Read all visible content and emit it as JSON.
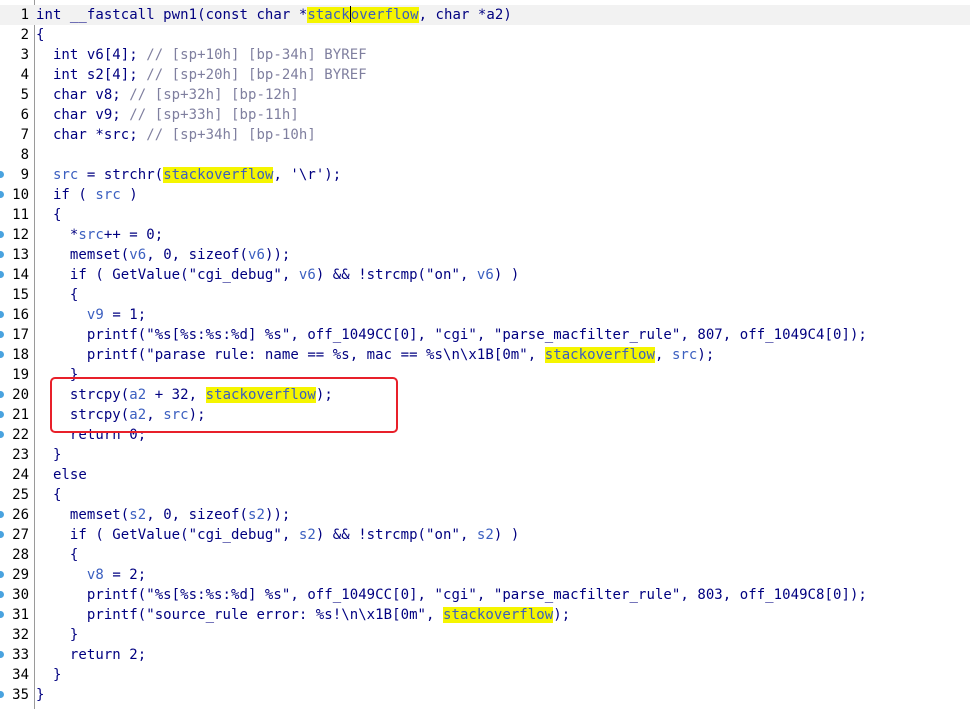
{
  "editor": {
    "current_line": 1,
    "highlight_word": "stackoverflow",
    "colors": {
      "text": "#000080",
      "variable": "#3b5fc0",
      "comment": "#7f7f9f",
      "highlight": "#f5f500",
      "annotation_box": "#e8202a",
      "breakpoint_dot": "#4aa3df"
    },
    "annotation": "red-box-around-lines-20-21",
    "lines": [
      {
        "num": "1",
        "dot": false,
        "tokens": [
          {
            "t": "int __fastcall pwn1(const char *",
            "k": "n"
          },
          {
            "t": "stack",
            "k": "hl"
          },
          {
            "t": "",
            "k": "caret"
          },
          {
            "t": "overflow",
            "k": "hl"
          },
          {
            "t": ", char *a2)",
            "k": "n"
          }
        ]
      },
      {
        "num": "2",
        "dot": false,
        "tokens": [
          {
            "t": "{",
            "k": "n"
          }
        ]
      },
      {
        "num": "3",
        "dot": false,
        "tokens": [
          {
            "t": "  int v6[4]; ",
            "k": "n"
          },
          {
            "t": "// [sp+10h] [bp-34h] BYREF",
            "k": "c"
          }
        ]
      },
      {
        "num": "4",
        "dot": false,
        "tokens": [
          {
            "t": "  int s2[4]; ",
            "k": "n"
          },
          {
            "t": "// [sp+20h] [bp-24h] BYREF",
            "k": "c"
          }
        ]
      },
      {
        "num": "5",
        "dot": false,
        "tokens": [
          {
            "t": "  char v8; ",
            "k": "n"
          },
          {
            "t": "// [sp+32h] [bp-12h]",
            "k": "c"
          }
        ]
      },
      {
        "num": "6",
        "dot": false,
        "tokens": [
          {
            "t": "  char v9; ",
            "k": "n"
          },
          {
            "t": "// [sp+33h] [bp-11h]",
            "k": "c"
          }
        ]
      },
      {
        "num": "7",
        "dot": false,
        "tokens": [
          {
            "t": "  char *src; ",
            "k": "n"
          },
          {
            "t": "// [sp+34h] [bp-10h]",
            "k": "c"
          }
        ]
      },
      {
        "num": "8",
        "dot": false,
        "tokens": [
          {
            "t": "",
            "k": "n"
          }
        ]
      },
      {
        "num": "9",
        "dot": true,
        "tokens": [
          {
            "t": "  ",
            "k": "n"
          },
          {
            "t": "src",
            "k": "v"
          },
          {
            "t": " = strchr(",
            "k": "n"
          },
          {
            "t": "stackoverflow",
            "k": "hl"
          },
          {
            "t": ", '\\r');",
            "k": "n"
          }
        ]
      },
      {
        "num": "10",
        "dot": true,
        "tokens": [
          {
            "t": "  if ( ",
            "k": "n"
          },
          {
            "t": "src",
            "k": "v"
          },
          {
            "t": " )",
            "k": "n"
          }
        ]
      },
      {
        "num": "11",
        "dot": false,
        "tokens": [
          {
            "t": "  {",
            "k": "n"
          }
        ]
      },
      {
        "num": "12",
        "dot": true,
        "tokens": [
          {
            "t": "    *",
            "k": "n"
          },
          {
            "t": "src",
            "k": "v"
          },
          {
            "t": "++ = 0;",
            "k": "n"
          }
        ]
      },
      {
        "num": "13",
        "dot": true,
        "tokens": [
          {
            "t": "    memset(",
            "k": "n"
          },
          {
            "t": "v6",
            "k": "v"
          },
          {
            "t": ", 0, sizeof(",
            "k": "n"
          },
          {
            "t": "v6",
            "k": "v"
          },
          {
            "t": "));",
            "k": "n"
          }
        ]
      },
      {
        "num": "14",
        "dot": true,
        "tokens": [
          {
            "t": "    if ( GetValue(\"cgi_debug\", ",
            "k": "n"
          },
          {
            "t": "v6",
            "k": "v"
          },
          {
            "t": ") && !strcmp(\"on\", ",
            "k": "n"
          },
          {
            "t": "v6",
            "k": "v"
          },
          {
            "t": ") )",
            "k": "n"
          }
        ]
      },
      {
        "num": "15",
        "dot": false,
        "tokens": [
          {
            "t": "    {",
            "k": "n"
          }
        ]
      },
      {
        "num": "16",
        "dot": true,
        "tokens": [
          {
            "t": "      ",
            "k": "n"
          },
          {
            "t": "v9",
            "k": "v"
          },
          {
            "t": " = 1;",
            "k": "n"
          }
        ]
      },
      {
        "num": "17",
        "dot": true,
        "tokens": [
          {
            "t": "      printf(\"%s[%s:%s:%d] %s\", off_1049CC[0], \"cgi\", \"parse_macfilter_rule\", 807, off_1049C4[0]);",
            "k": "n"
          }
        ]
      },
      {
        "num": "18",
        "dot": true,
        "tokens": [
          {
            "t": "      printf(\"parase rule: name == %s, mac == %s\\n\\x1B[0m\", ",
            "k": "n"
          },
          {
            "t": "stackoverflow",
            "k": "hl"
          },
          {
            "t": ", ",
            "k": "n"
          },
          {
            "t": "src",
            "k": "v"
          },
          {
            "t": ");",
            "k": "n"
          }
        ]
      },
      {
        "num": "19",
        "dot": false,
        "tokens": [
          {
            "t": "    }",
            "k": "n"
          }
        ]
      },
      {
        "num": "20",
        "dot": true,
        "tokens": [
          {
            "t": "    strcpy(",
            "k": "n"
          },
          {
            "t": "a2",
            "k": "v"
          },
          {
            "t": " + 32, ",
            "k": "n"
          },
          {
            "t": "stackoverflow",
            "k": "hl"
          },
          {
            "t": ");",
            "k": "n"
          }
        ]
      },
      {
        "num": "21",
        "dot": true,
        "tokens": [
          {
            "t": "    strcpy(",
            "k": "n"
          },
          {
            "t": "a2",
            "k": "v"
          },
          {
            "t": ", ",
            "k": "n"
          },
          {
            "t": "src",
            "k": "v"
          },
          {
            "t": ");",
            "k": "n"
          }
        ]
      },
      {
        "num": "22",
        "dot": true,
        "tokens": [
          {
            "t": "    return 0;",
            "k": "n"
          }
        ]
      },
      {
        "num": "23",
        "dot": false,
        "tokens": [
          {
            "t": "  }",
            "k": "n"
          }
        ]
      },
      {
        "num": "24",
        "dot": false,
        "tokens": [
          {
            "t": "  else",
            "k": "n"
          }
        ]
      },
      {
        "num": "25",
        "dot": false,
        "tokens": [
          {
            "t": "  {",
            "k": "n"
          }
        ]
      },
      {
        "num": "26",
        "dot": true,
        "tokens": [
          {
            "t": "    memset(",
            "k": "n"
          },
          {
            "t": "s2",
            "k": "v"
          },
          {
            "t": ", 0, sizeof(",
            "k": "n"
          },
          {
            "t": "s2",
            "k": "v"
          },
          {
            "t": "));",
            "k": "n"
          }
        ]
      },
      {
        "num": "27",
        "dot": true,
        "tokens": [
          {
            "t": "    if ( GetValue(\"cgi_debug\", ",
            "k": "n"
          },
          {
            "t": "s2",
            "k": "v"
          },
          {
            "t": ") && !strcmp(\"on\", ",
            "k": "n"
          },
          {
            "t": "s2",
            "k": "v"
          },
          {
            "t": ") )",
            "k": "n"
          }
        ]
      },
      {
        "num": "28",
        "dot": false,
        "tokens": [
          {
            "t": "    {",
            "k": "n"
          }
        ]
      },
      {
        "num": "29",
        "dot": true,
        "tokens": [
          {
            "t": "      ",
            "k": "n"
          },
          {
            "t": "v8",
            "k": "v"
          },
          {
            "t": " = 2;",
            "k": "n"
          }
        ]
      },
      {
        "num": "30",
        "dot": true,
        "tokens": [
          {
            "t": "      printf(\"%s[%s:%s:%d] %s\", off_1049CC[0], \"cgi\", \"parse_macfilter_rule\", 803, off_1049C8[0]);",
            "k": "n"
          }
        ]
      },
      {
        "num": "31",
        "dot": true,
        "tokens": [
          {
            "t": "      printf(\"source_rule error: %s!\\n\\x1B[0m\", ",
            "k": "n"
          },
          {
            "t": "stackoverflow",
            "k": "hl"
          },
          {
            "t": ");",
            "k": "n"
          }
        ]
      },
      {
        "num": "32",
        "dot": false,
        "tokens": [
          {
            "t": "    }",
            "k": "n"
          }
        ]
      },
      {
        "num": "33",
        "dot": true,
        "tokens": [
          {
            "t": "    return 2;",
            "k": "n"
          }
        ]
      },
      {
        "num": "34",
        "dot": false,
        "tokens": [
          {
            "t": "  }",
            "k": "n"
          }
        ]
      },
      {
        "num": "35",
        "dot": true,
        "tokens": [
          {
            "t": "}",
            "k": "n"
          }
        ]
      }
    ]
  }
}
